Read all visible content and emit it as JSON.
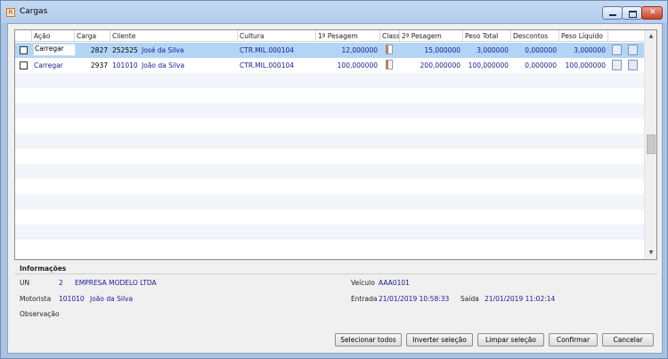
{
  "window": {
    "title": "Cargas",
    "icon": "app-icon"
  },
  "grid": {
    "columns": [
      "",
      "Ação",
      "Carga",
      "Cliente",
      "Cultura",
      "1ª Pesagem",
      "Class.",
      "2ª Pesagem",
      "Peso Total",
      "Descontos",
      "Peso Líquido"
    ],
    "rows": [
      {
        "selected": true,
        "acao": "Carregar",
        "carga": "2827",
        "cliente_cod": "252525",
        "cliente_nome": "José da Silva",
        "cultura": "CTR.MIL.000104",
        "pesagem1": "12,000000",
        "pesagem2": "15,000000",
        "peso_total": "3,000000",
        "descontos": "0,000000",
        "peso_liquido": "3,000000"
      },
      {
        "selected": false,
        "acao": "Carregar",
        "carga": "2937",
        "cliente_cod": "101010",
        "cliente_nome": "João da Silva",
        "cultura": "CTR.MIL.000104",
        "pesagem1": "100,000000",
        "pesagem2": "200,000000",
        "peso_total": "100,000000",
        "descontos": "0,000000",
        "peso_liquido": "100,000000"
      }
    ]
  },
  "info": {
    "title": "Informações",
    "un_label": "UN",
    "un_code": "2",
    "un_name": "EMPRESA MODELO LTDA",
    "veiculo_label": "Veículo",
    "veiculo_value": "AAA0101",
    "motorista_label": "Motorista",
    "motorista_code": "101010",
    "motorista_name": "João da Silva",
    "entrada_label": "Entrada",
    "entrada_value": "21/01/2019  10:58:33",
    "saida_label": "Saída",
    "saida_value": "21/01/2019  11:02:14",
    "observacao_label": "Observação"
  },
  "buttons": {
    "select_all": "Selecionar todos",
    "invert": "Inverter seleção",
    "clear": "Limpar seleção",
    "confirm": "Confirmar",
    "cancel": "Cancelar"
  },
  "colors": {
    "selected_row": "#b3d5f5",
    "value_text": "#1a1a9a",
    "title_bar": "#b3cceb"
  }
}
